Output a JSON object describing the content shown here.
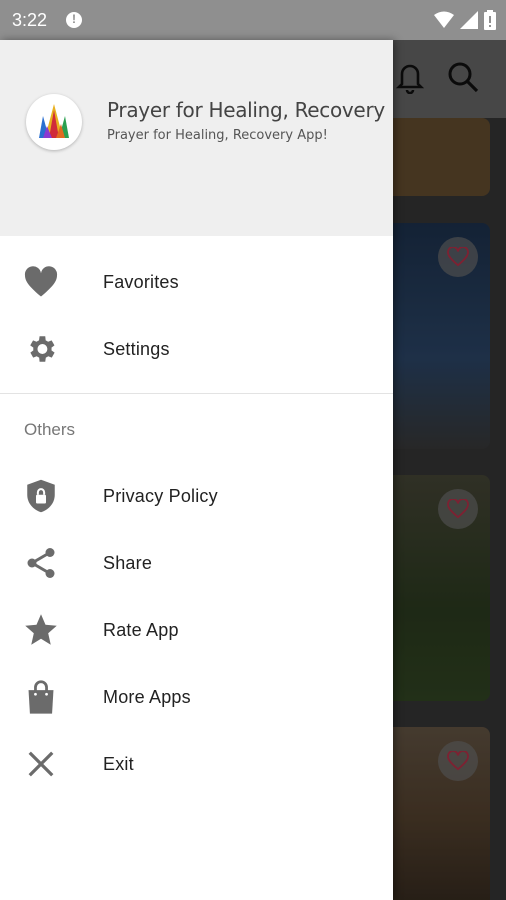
{
  "status_bar": {
    "time": "3:22",
    "icons": [
      "notification-icon",
      "wifi-icon",
      "signal-icon",
      "battery-icon"
    ]
  },
  "drawer": {
    "header": {
      "title": "Prayer for Healing, Recovery",
      "subtitle": "Prayer for Healing, Recovery App!"
    },
    "primary_items": [
      {
        "label": "Favorites",
        "icon": "heart-icon"
      },
      {
        "label": "Settings",
        "icon": "gear-icon"
      }
    ],
    "section_label": "Others",
    "other_items": [
      {
        "label": "Privacy Policy",
        "icon": "shield-lock-icon"
      },
      {
        "label": "Share",
        "icon": "share-icon"
      },
      {
        "label": "Rate App",
        "icon": "star-icon"
      },
      {
        "label": "More Apps",
        "icon": "shopping-bag-icon"
      },
      {
        "label": "Exit",
        "icon": "close-icon"
      }
    ]
  },
  "background_app": {
    "toolbar_icons": [
      "bell-icon",
      "search-icon"
    ],
    "card_icons": [
      "heart-outline-icon",
      "heart-outline-icon",
      "heart-outline-icon"
    ]
  },
  "colors": {
    "drawer_header": "#efefef",
    "icon_gray": "#6b6b6b",
    "status_bar": "#8f8f8f"
  }
}
